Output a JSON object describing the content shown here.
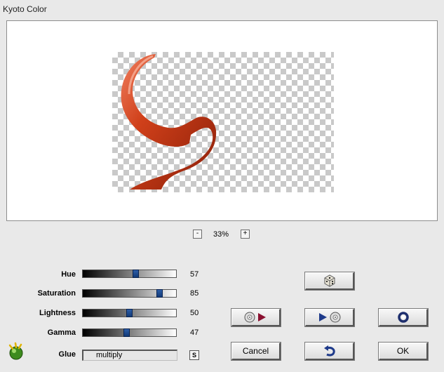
{
  "window": {
    "title": "Kyoto Color"
  },
  "zoom": {
    "minus_label": "-",
    "value": "33%",
    "plus_label": "+"
  },
  "sliders": [
    {
      "label": "Hue",
      "value": "57",
      "level": 0.57
    },
    {
      "label": "Saturation",
      "value": "85",
      "level": 0.85
    },
    {
      "label": "Lightness",
      "value": "50",
      "level": 0.5
    },
    {
      "label": "Gamma",
      "value": "47",
      "level": 0.47
    }
  ],
  "glue": {
    "label": "Glue",
    "value": "multiply",
    "s_label": "S"
  },
  "buttons": {
    "randomize_icon": "dice-icon",
    "play_forward_icon": "disc-play-icon",
    "play_back_icon": "play-disc-icon",
    "ring_icon": "ring-icon",
    "undo_icon": "undo-arrow-icon",
    "cancel_label": "Cancel",
    "ok_label": "OK"
  },
  "colors": {
    "accent": "#1e4a8f",
    "shape_red": "#d0401a",
    "background": "#e9e9e9"
  }
}
